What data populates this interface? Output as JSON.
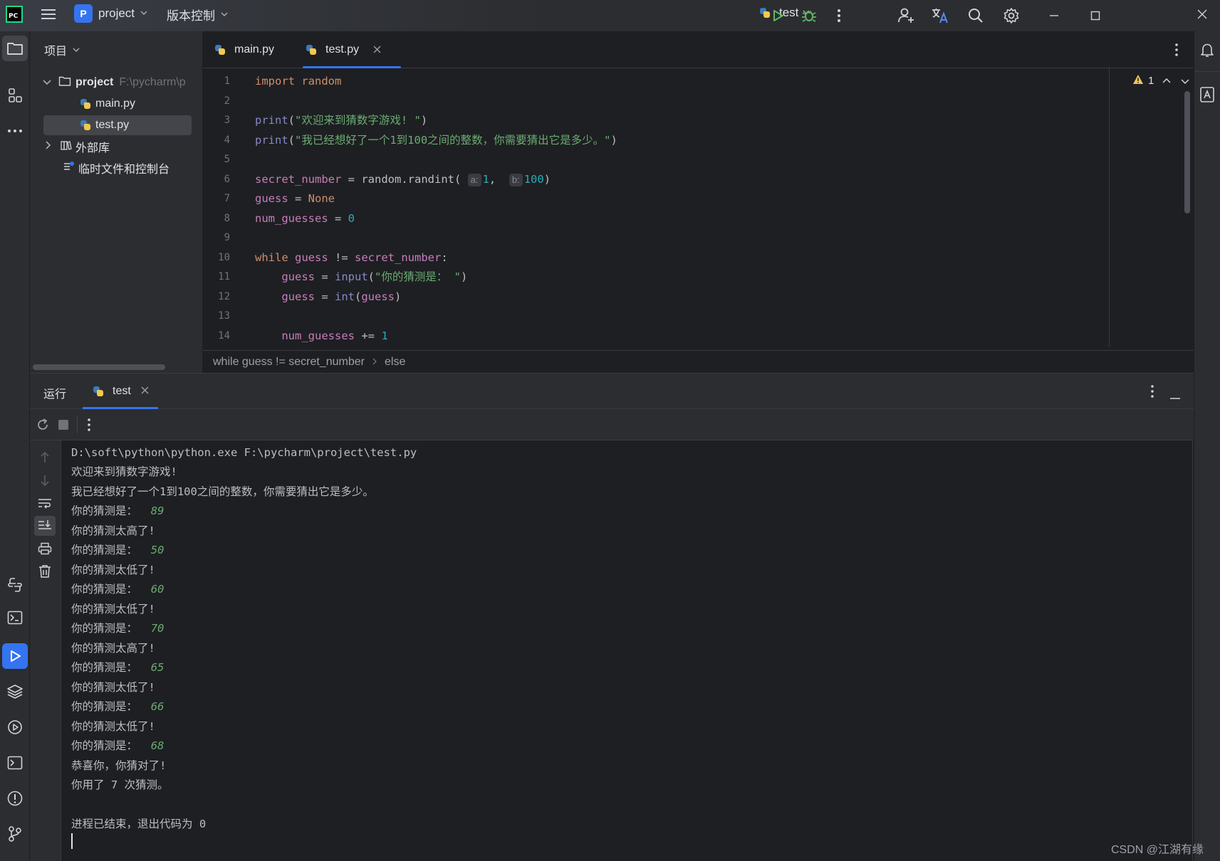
{
  "titlebar": {
    "app_logo_text": "PC",
    "project_avatar": "P",
    "project_name": "project",
    "vcs_label": "版本控制",
    "run_config": "test",
    "icons": [
      "menu-icon",
      "run-icon",
      "debug-icon",
      "more-icon",
      "add-user-icon",
      "translate-icon",
      "search-icon",
      "settings-icon",
      "minimize-icon",
      "maximize-icon",
      "close-icon"
    ]
  },
  "project_panel": {
    "header": "项目",
    "tree": [
      {
        "label": "project",
        "path": "F:\\pycharm\\p"
      },
      {
        "label": "main.py"
      },
      {
        "label": "test.py"
      },
      {
        "label": "外部库"
      },
      {
        "label": "临时文件和控制台"
      }
    ]
  },
  "editor": {
    "tabs": [
      {
        "label": "main.py"
      },
      {
        "label": "test.py",
        "active": true
      }
    ],
    "line_numbers": [
      "1",
      "2",
      "3",
      "4",
      "5",
      "6",
      "7",
      "8",
      "9",
      "10",
      "11",
      "12",
      "13",
      "14"
    ],
    "warning_count": "1",
    "breadcrumbs": [
      "while guess != secret_number",
      "else"
    ],
    "code": {
      "l1_kw": "import",
      "l1_mod": " random",
      "l3_fn": "print",
      "l3_str": "\"欢迎来到猜数字游戏! \"",
      "l4_fn": "print",
      "l4_str": "\"我已经想好了一个1到100之间的整数，你需要猜出它是多少。\"",
      "l6_var": "secret_number",
      "l6_mid": " = random.",
      "l6_fn": "randint",
      "l6_hint_a": "a:",
      "l6_a": "1",
      "l6_hint_b": "b:",
      "l6_b": "100",
      "l7_var": "guess",
      "l7_kw": "None",
      "l8_var": "num_guesses",
      "l8_num": "0",
      "l10_kw": "while",
      "l10_v1": "guess",
      "l10_op": " != ",
      "l10_v2": "secret_number",
      "l11_var": "guess",
      "l11_fn": "input",
      "l11_str": "\"你的猜测是： \"",
      "l12_var": "guess",
      "l12_fn": "int",
      "l12_arg": "guess",
      "l14_var": "num_guesses",
      "l14_op": " += ",
      "l14_num": "1"
    }
  },
  "run_panel": {
    "title": "运行",
    "tab_label": "test",
    "console": [
      {
        "text": "D:\\soft\\python\\python.exe F:\\pycharm\\project\\test.py"
      },
      {
        "text": "欢迎来到猜数字游戏!"
      },
      {
        "text": "我已经想好了一个1到100之间的整数，你需要猜出它是多少。"
      },
      {
        "text": "你的猜测是：",
        "input": "89"
      },
      {
        "text": "你的猜测太高了!"
      },
      {
        "text": "你的猜测是：",
        "input": "50"
      },
      {
        "text": "你的猜测太低了!"
      },
      {
        "text": "你的猜测是：",
        "input": "60"
      },
      {
        "text": "你的猜测太低了!"
      },
      {
        "text": "你的猜测是：",
        "input": "70"
      },
      {
        "text": "你的猜测太高了!"
      },
      {
        "text": "你的猜测是：",
        "input": "65"
      },
      {
        "text": "你的猜测太低了!"
      },
      {
        "text": "你的猜测是：",
        "input": "66"
      },
      {
        "text": "你的猜测太低了!"
      },
      {
        "text": "你的猜测是：",
        "input": "68"
      },
      {
        "text": "恭喜你，你猜对了!"
      },
      {
        "text": "你用了 7 次猜测。"
      },
      {
        "text": ""
      },
      {
        "text": "进程已结束，退出代码为 0"
      }
    ]
  },
  "watermark": "CSDN @江湖有缘",
  "colors": {
    "accent": "#3574f0",
    "bg_editor": "#1e1f22",
    "bg_panel": "#2b2d30",
    "keyword": "#cf8e6d",
    "string": "#6aab73",
    "number": "#2aacb8",
    "variable": "#c77dbb"
  }
}
